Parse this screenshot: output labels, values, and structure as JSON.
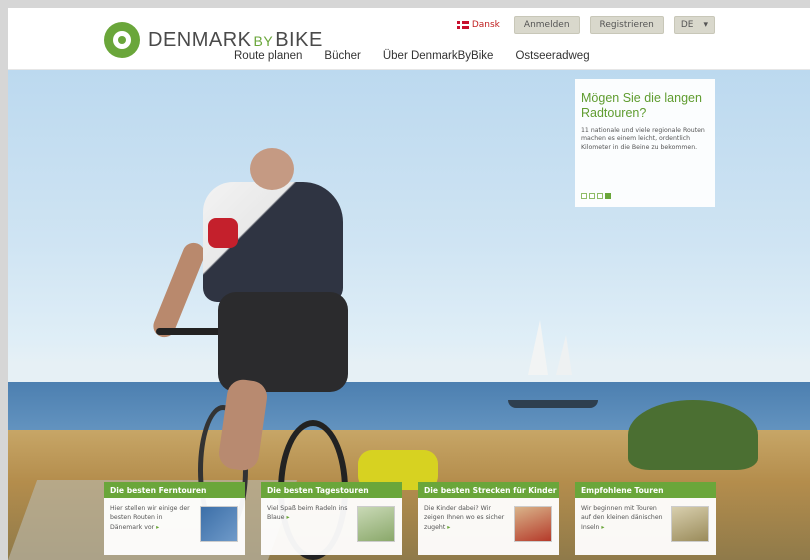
{
  "header": {
    "logo_text_1": "DENMARK",
    "logo_text_by": "BY",
    "logo_text_2": "BIKE",
    "dansk_label": "Dansk",
    "login_label": "Anmelden",
    "register_label": "Registrieren",
    "language": {
      "selected": "DE",
      "caret": "▾"
    },
    "nav": [
      "Route planen",
      "Bücher",
      "Über DenmarkByBike",
      "Ostseeradweg"
    ]
  },
  "promo": {
    "title": "Mögen Sie die langen Radtouren?",
    "text": "11 nationale und viele regionale Routen machen es einem leicht, ordentlich Kilometer in die Beine zu bekommen.",
    "slides_total": 4,
    "active_slide": 4
  },
  "cards": [
    {
      "title": "Die besten Ferntouren",
      "text": "Hier stellen wir einige der besten Routen in Dänemark vor",
      "thumb_color": "#3c6fa8"
    },
    {
      "title": "Die besten Tagestouren",
      "text": "Viel Spaß beim Radeln ins Blaue",
      "thumb_color": "#8aa86a"
    },
    {
      "title": "Die besten Strecken für Kinder",
      "text": "Die Kinder dabei? Wir zeigen Ihnen wo es sicher zugeht",
      "thumb_color": "#b53a2a"
    },
    {
      "title": "Empfohlene Touren",
      "text": "Wir beginnen mit Touren auf den kleinen dänischen Inseln",
      "thumb_color": "#9a8b5a"
    }
  ],
  "colors": {
    "brand_green": "#6aa63a",
    "button_bg": "#d9d8cc"
  }
}
